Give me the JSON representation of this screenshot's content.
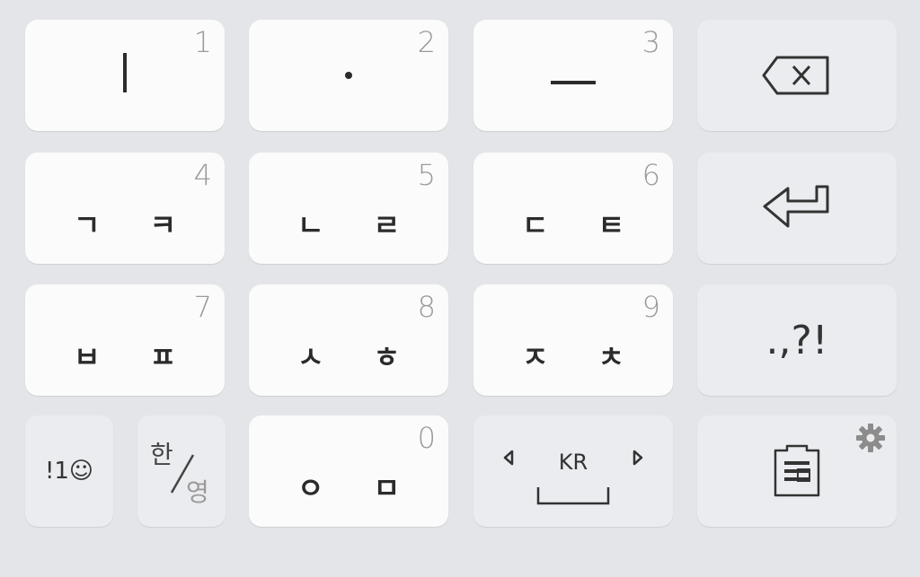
{
  "keyboard": {
    "row1": [
      {
        "main": "ㅣ",
        "num": "1"
      },
      {
        "main": "·",
        "num": "2"
      },
      {
        "main": "ㅡ",
        "num": "3"
      }
    ],
    "row2": [
      {
        "main": "ㄱ ㅋ",
        "num": "4"
      },
      {
        "main": "ㄴ ㄹ",
        "num": "5"
      },
      {
        "main": "ㄷ ㅌ",
        "num": "6"
      }
    ],
    "row3": [
      {
        "main": "ㅂ ㅍ",
        "num": "7"
      },
      {
        "main": "ㅅ ㅎ",
        "num": "8"
      },
      {
        "main": "ㅈ ㅊ",
        "num": "9"
      }
    ],
    "punct_label": ".,?!",
    "symbols_label": "!1☺",
    "lang_top": "한",
    "lang_bottom": "영",
    "zero_key": {
      "main": "ㅇ ㅁ",
      "num": "0"
    },
    "space_lang": "KR",
    "icons": {
      "backspace": "backspace-icon",
      "enter": "enter-icon",
      "settings": "gear-icon",
      "clipboard": "clipboard-icon"
    }
  }
}
